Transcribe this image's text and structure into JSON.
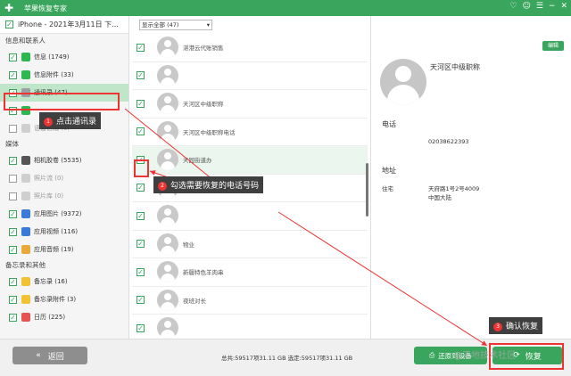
{
  "app": {
    "title": "苹果恢复专家",
    "controls": [
      "♡",
      "☺",
      "☰",
      "−",
      "✕"
    ]
  },
  "sidebar": {
    "device": "iPhone - 2021年3月11日 下...",
    "sections": [
      {
        "title": "信息和联系人",
        "items": [
          {
            "label": "信息 (1749)",
            "checked": true,
            "color": "#2db84f"
          },
          {
            "label": "信息附件 (33)",
            "checked": true,
            "color": "#2db84f"
          },
          {
            "label": "通讯录 (47)",
            "checked": true,
            "color": "#9aa0a6",
            "selected": true
          },
          {
            "label": "",
            "checked": true,
            "color": "#2db84f"
          },
          {
            "label": "语音信箱 (0)",
            "checked": false,
            "color": "#cfcfcf",
            "grey": true
          }
        ]
      },
      {
        "title": "媒体",
        "items": [
          {
            "label": "相机胶卷 (5535)",
            "checked": true,
            "color": "#555555"
          },
          {
            "label": "照片流 (0)",
            "checked": false,
            "color": "#cfcfcf",
            "grey": true
          },
          {
            "label": "照片库 (0)",
            "checked": false,
            "color": "#cfcfcf",
            "grey": true
          },
          {
            "label": "应用图片 (9372)",
            "checked": true,
            "color": "#3b7ad9"
          },
          {
            "label": "应用视频 (116)",
            "checked": true,
            "color": "#3b7ad9"
          },
          {
            "label": "应用音频 (19)",
            "checked": true,
            "color": "#e8a93a"
          }
        ]
      },
      {
        "title": "备忘录和其他",
        "items": [
          {
            "label": "备忘录 (16)",
            "checked": true,
            "color": "#f1c232"
          },
          {
            "label": "备忘录附件 (3)",
            "checked": true,
            "color": "#f1c232"
          },
          {
            "label": "日历 (225)",
            "checked": true,
            "color": "#e55353"
          }
        ]
      }
    ]
  },
  "list": {
    "filter": "显示全部 (47)",
    "rows": [
      {
        "name": "湛港云代账销售",
        "checked": true
      },
      {
        "name": "",
        "checked": true
      },
      {
        "name": "天河区中级职称",
        "checked": true
      },
      {
        "name": "天河区中级职称电话",
        "checked": true
      },
      {
        "name": "天园街道办",
        "checked": true,
        "selected": true
      },
      {
        "name": "",
        "checked": true
      },
      {
        "name": "",
        "checked": true
      },
      {
        "name": "物业",
        "checked": true
      },
      {
        "name": "新疆特色羊肉串",
        "checked": true
      },
      {
        "name": "夜班对长",
        "checked": true
      },
      {
        "name": "",
        "checked": true
      }
    ]
  },
  "detail": {
    "edit": "编辑",
    "name": "天河区中级职称",
    "phone_title": "电话",
    "phone": "02038622393",
    "address_title": "地址",
    "address_label": "住宅",
    "address_line1": "天府路1号2号4009",
    "address_line2": "中国大陆"
  },
  "bottom": {
    "back": "返回",
    "back_icon": "«",
    "stats": "总共:59517项31.11 GB  选定:59517项31.11 GB",
    "to_device": "还原到设备",
    "recover": "恢复"
  },
  "annotations": [
    {
      "num": "1",
      "text": "点击通讯录"
    },
    {
      "num": "2",
      "text": "勾选需要恢复的电话号码"
    },
    {
      "num": "3",
      "text": "确认恢复"
    }
  ],
  "watermark": "@天地技术社区",
  "colors": {
    "brand": "#3aa55d",
    "highlight": "#e33333"
  }
}
